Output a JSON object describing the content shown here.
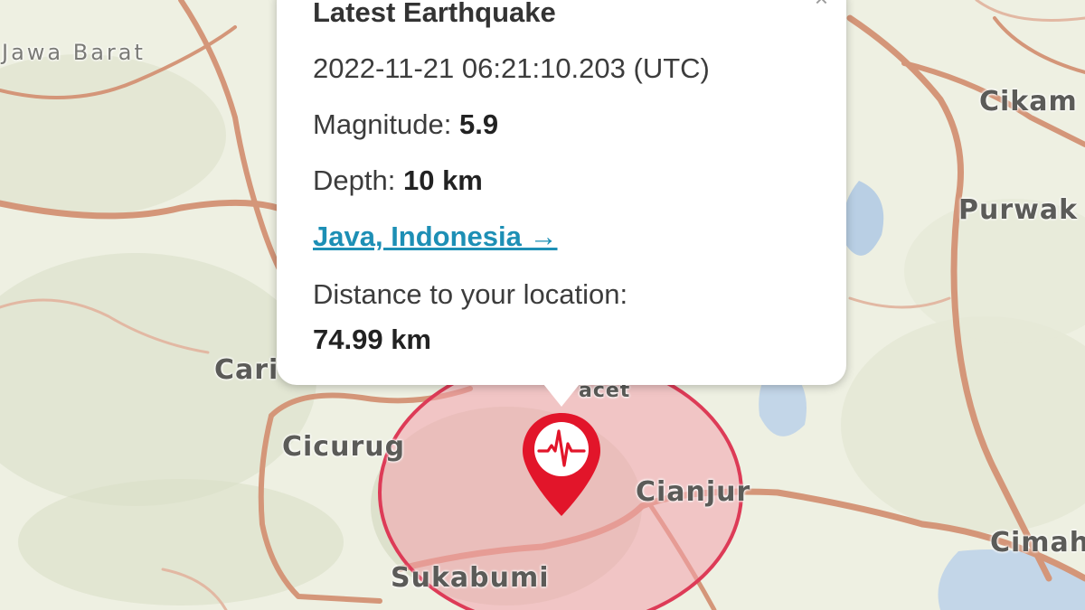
{
  "map": {
    "labels": {
      "jawa_barat": "Jawa Barat",
      "cikampek": "Cikam",
      "purwakarta": "Purwak",
      "cariu": "Cari",
      "cicurug": "Cicurug",
      "cianjur": "Cianjur",
      "cimahi": "Cimah",
      "sukabumi": "Sukabumi",
      "cipanas": "acet"
    },
    "colors": {
      "background": "#eef0e2",
      "road": "#d49679",
      "water": "#b9cfe4",
      "radius_fill": "#f4a3ad",
      "radius_stroke": "#dd3b57",
      "marker": "#e2152a"
    }
  },
  "popup": {
    "title": "Latest Earthquake",
    "close_symbol": "×",
    "time": "2022-11-21 06:21:10.203 (UTC)",
    "magnitude_label": "Magnitude:",
    "magnitude_value": "5.9",
    "depth_label": "Depth:",
    "depth_value": "10 km",
    "location_link": "Java, Indonesia →",
    "distance_label": "Distance to your location:",
    "distance_value": "74.99 km"
  },
  "marker": {
    "icon": "seismograph-pin-icon"
  }
}
